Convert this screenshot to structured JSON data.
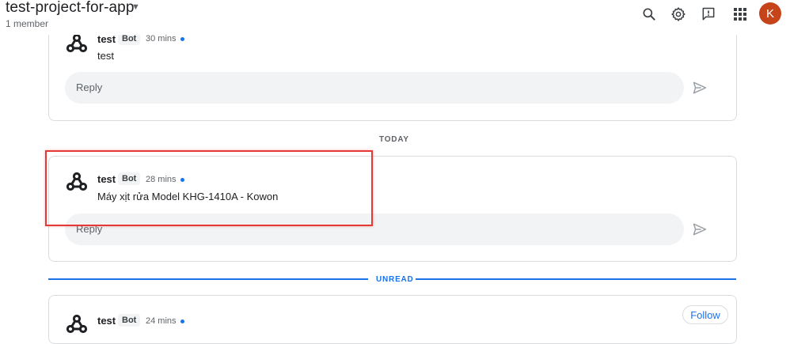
{
  "header": {
    "room_title": "test-project-for-app",
    "member_count": "1 member",
    "avatar_letter": "K"
  },
  "messages": [
    {
      "sender": "test",
      "badge": "Bot",
      "time": "30 mins",
      "text": "test",
      "reply_placeholder": "Reply"
    },
    {
      "sender": "test",
      "badge": "Bot",
      "time": "28 mins",
      "text": "Máy xịt rửa Model KHG-1410A - Kowon",
      "reply_placeholder": "Reply"
    },
    {
      "sender": "test",
      "badge": "Bot",
      "time": "24 mins",
      "follow_label": "Follow"
    }
  ],
  "dividers": {
    "today": "TODAY",
    "unread": "UNREAD"
  },
  "colors": {
    "accent": "#1a73e8",
    "avatar": "#c5441a",
    "highlight": "#e53935"
  }
}
